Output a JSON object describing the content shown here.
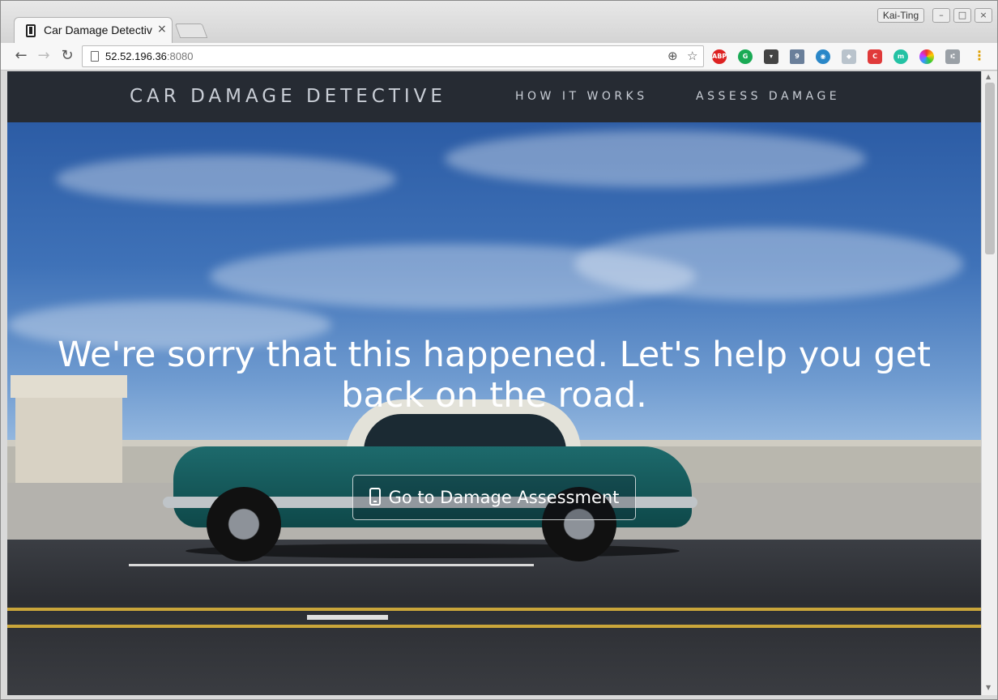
{
  "browser": {
    "tab_title": "Car Damage Detective",
    "tab_close": "×",
    "profile_name": "Kai-Ting",
    "url_host": "52.52.196.36",
    "url_port": ":8080",
    "extensions": [
      "abp-icon",
      "grammarly-icon",
      "pocket-icon",
      "tab-counter-icon",
      "eye-icon",
      "dropbox-icon",
      "shield-icon",
      "m-icon",
      "colorwheel-icon",
      "proxy-icon"
    ],
    "ext_badge": "9",
    "ext_abp": "ABP"
  },
  "site": {
    "brand": "CAR DAMAGE DETECTIVE",
    "nav": [
      "HOW IT WORKS",
      "ASSESS DAMAGE"
    ],
    "headline": "We're sorry that this happened. Let's help you get back on the road.",
    "cta_label": "Go to Damage Assessment"
  },
  "colors": {
    "navbar": "#262b33",
    "nav_text": "#c9ced6"
  }
}
